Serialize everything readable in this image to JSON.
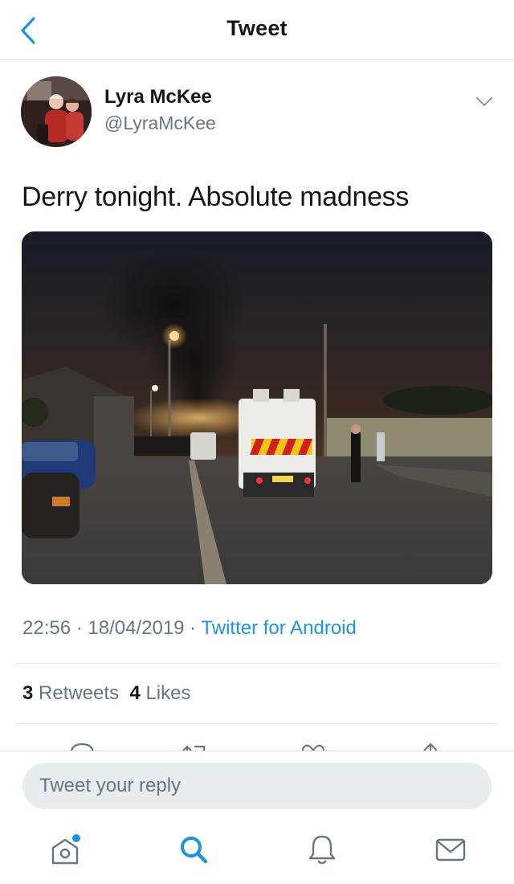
{
  "header": {
    "title": "Tweet",
    "back_icon": "chevron-left-icon"
  },
  "author": {
    "display_name": "Lyra McKee",
    "handle": "@LyraMcKee",
    "avatar": "avatar-photo",
    "more_icon": "chevron-down-icon"
  },
  "tweet": {
    "text": "Derry tonight. Absolute madness",
    "media": "photo-street-night-police-vehicle-smoke"
  },
  "meta": {
    "time": "22:56",
    "separator": " · ",
    "date": "18/04/2019",
    "source": "Twitter for Android"
  },
  "stats": {
    "retweets_count": "3",
    "retweets_label": "Retweets",
    "likes_count": "4",
    "likes_label": "Likes"
  },
  "actions": [
    "reply-icon",
    "retweet-icon",
    "like-icon",
    "share-icon"
  ],
  "reply": {
    "placeholder": "Tweet your reply"
  },
  "nav": [
    "home-icon",
    "search-icon",
    "notifications-icon",
    "messages-icon"
  ],
  "colors": {
    "accent": "#1b95e0",
    "secondary_text": "#657786",
    "primary_text": "#14171a",
    "reply_bg": "#e6ecf0"
  }
}
